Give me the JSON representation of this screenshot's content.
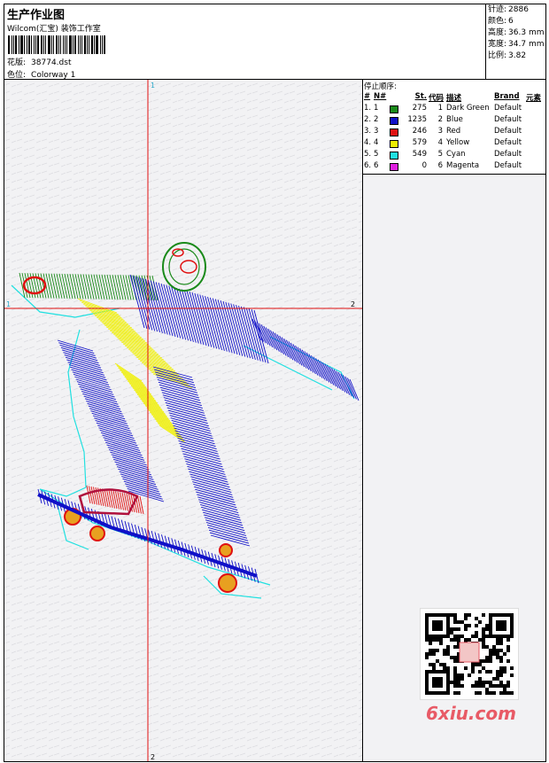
{
  "header": {
    "title": "生产作业图",
    "studio": "Wilcom(汇宝) 装饰工作室",
    "design_label": "花版:",
    "design_file": "38774.dst",
    "colorway_label": "色位:",
    "colorway": "Colorway 1"
  },
  "stats": {
    "stitches_label": "针迹:",
    "stitches": "2886",
    "colors_label": "颜色:",
    "colors": "6",
    "height_label": "高度:",
    "height": "36.3 mm",
    "width_label": "宽度:",
    "width": "34.7 mm",
    "scale_label": "比例:",
    "scale": "3.82"
  },
  "canvas": {
    "axis_v_top": "1",
    "axis_v_bottom": "2",
    "axis_h_left": "1",
    "axis_h_right": "2"
  },
  "sequence": {
    "title": "停止顺序:",
    "headers": {
      "hash": "#",
      "n": "N#",
      "st": "St.",
      "code": "代码",
      "desc": "描述",
      "brand": "Brand",
      "element": "元素"
    },
    "rows": [
      {
        "hash": "1.",
        "n": "1",
        "color": "#1a8a1a",
        "st": "275",
        "code": "1",
        "desc": "Dark Green",
        "brand": "Default"
      },
      {
        "hash": "2.",
        "n": "2",
        "color": "#1010c8",
        "st": "1235",
        "code": "2",
        "desc": "Blue",
        "brand": "Default"
      },
      {
        "hash": "3.",
        "n": "3",
        "color": "#e01010",
        "st": "246",
        "code": "3",
        "desc": "Red",
        "brand": "Default"
      },
      {
        "hash": "4.",
        "n": "4",
        "color": "#f0f000",
        "st": "579",
        "code": "4",
        "desc": "Yellow",
        "brand": "Default"
      },
      {
        "hash": "5.",
        "n": "5",
        "color": "#20e0e0",
        "st": "549",
        "code": "5",
        "desc": "Cyan",
        "brand": "Default"
      },
      {
        "hash": "6.",
        "n": "6",
        "color": "#e020e0",
        "st": "0",
        "code": "6",
        "desc": "Magenta",
        "brand": "Default"
      }
    ]
  },
  "watermark": {
    "logo": "6xiu.com"
  }
}
